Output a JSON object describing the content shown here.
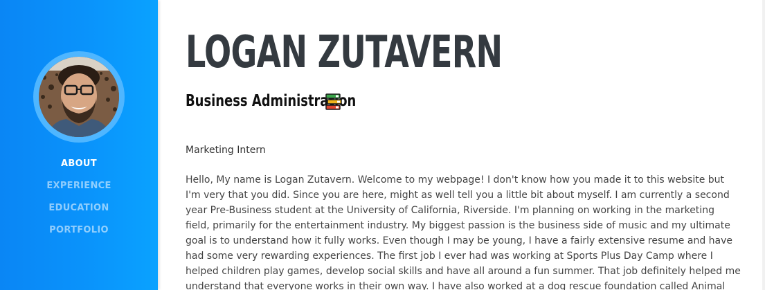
{
  "sidebar": {
    "nav": [
      {
        "label": "ABOUT",
        "active": true
      },
      {
        "label": "EXPERIENCE",
        "active": false
      },
      {
        "label": "EDUCATION",
        "active": false
      },
      {
        "label": "PORTFOLIO",
        "active": false
      }
    ],
    "colors": {
      "gradient_start": "#0a86f5",
      "gradient_end": "#0aa2ff",
      "ring": "#4fb6ff"
    }
  },
  "main": {
    "name": "LOGAN ZUTAVERN",
    "subheading": "Business Administration",
    "subheading_icon": "books-icon",
    "role": "Marketing Intern",
    "about_lines": [
      "Hello, My name is Logan Zutavern. Welcome to my webpage! I don't know how you made it to this website but",
      "I'm very that you did. Since you are here, might as well tell you a little bit about myself. I am currently a second",
      "year Pre-Business student at the University of California, Riverside. I'm planning on working in the marketing",
      "field, primarily for the entertainment industry. My biggest passion is the business side of music and my ultimate",
      "goal is to understand how it fully works. Even though I may be young, I have a fairly extensive resume and have",
      "had some very rewarding experiences. The first job I ever had was working at Sports Plus Day Camp where I",
      "helped children play games, develop social skills and have all around a fun summer. That job definitely helped me",
      "understand that everyone works in their own way. I have also worked at a dog rescue foundation called Animal"
    ],
    "colors": {
      "name": "#343a40",
      "text": "#444444"
    }
  }
}
